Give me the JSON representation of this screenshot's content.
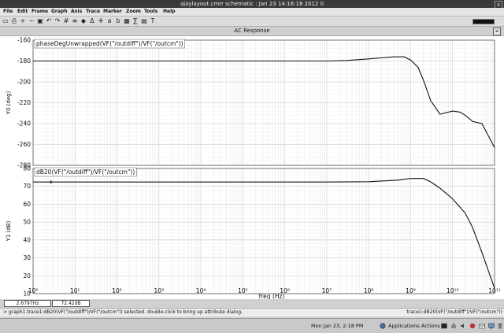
{
  "window": {
    "title": "ajaylayout.cmrr schematic : Jan 23 14:16:18 2012 0",
    "close_glyph": "x"
  },
  "menu": [
    "File",
    "Edit",
    "Frame",
    "Graph",
    "Axis",
    "Trace",
    "Marker",
    "Zoom",
    "Tools",
    "Help"
  ],
  "toolbar_icons": [
    "new-icon",
    "print-icon",
    "zoom-in-icon",
    "zoom-out-icon",
    "fit-icon",
    "undo-icon",
    "redo-icon",
    "grid-icon",
    "strip-icon",
    "marker-icon",
    "delta-icon",
    "crosshair-icon",
    "cursor-a-icon",
    "cursor-b-icon",
    "table-icon",
    "calc-icon",
    "legend-icon",
    "label-icon"
  ],
  "plot_title": "AC Response",
  "header_button": "≡",
  "x_tick_labels": [
    "10⁰",
    "10¹",
    "10²",
    "10³",
    "10⁴",
    "10⁵",
    "10⁶",
    "10⁷",
    "10⁸",
    "10⁹",
    "10¹⁰",
    "10¹¹"
  ],
  "x_axis_label": "freq (Hz)",
  "cursor": {
    "x": "2.6797Hz",
    "y": "72.42dB"
  },
  "status": {
    "left": "> graph1.trace1:dB20(VF(\"/outdiff\")/VF(\"/outcm\")) selected. double-click to bring up attribute dialog.",
    "right": "trace1:dB20(VF(\"/outdiff\")/VF(\"/outcm\"))"
  },
  "taskbar": {
    "datetime": "Mon Jan 23,  2:18 PM",
    "applications": "Applications",
    "actions": "Actions"
  },
  "chart_data": [
    {
      "type": "line",
      "title": "phaseDegUnwrapped(VF(\"/outdiff\")/VF(\"/outcm\"))",
      "xlabel": "freq (Hz)",
      "ylabel": "Y0 (deg)",
      "xscale": "log",
      "xlim": [
        1,
        100000000000
      ],
      "ylim": [
        -280,
        -160
      ],
      "yticks": [
        -160,
        -180,
        -200,
        -220,
        -240,
        -260,
        -280
      ],
      "grid": true,
      "series": [
        {
          "name": "phaseDegUnwrapped(VF(\"/outdiff\")/VF(\"/outcm\"))",
          "x": [
            1,
            1000000,
            10000000,
            30000000,
            100000000,
            200000000,
            400000000,
            700000000,
            1000000000,
            1500000000,
            2000000000,
            3000000000,
            5000000000,
            10000000000,
            15000000000,
            20000000000,
            30000000000,
            50000000000,
            100000000000
          ],
          "y": [
            -180,
            -180,
            -180,
            -179.5,
            -178,
            -177,
            -176,
            -176,
            -179,
            -186,
            -198,
            -218,
            -231,
            -228,
            -229,
            -232,
            -238,
            -240,
            -263
          ]
        }
      ]
    },
    {
      "type": "line",
      "title": "dB20(VF(\"/outdiff\")/VF(\"/outcm\"))",
      "xlabel": "freq (Hz)",
      "ylabel": "Y1 (dB)",
      "xscale": "log",
      "xlim": [
        1,
        100000000000
      ],
      "ylim": [
        10,
        80
      ],
      "yticks": [
        80,
        70,
        60,
        50,
        40,
        30,
        20,
        10
      ],
      "grid": true,
      "series": [
        {
          "name": "dB20(VF(\"/outdiff\")/VF(\"/outcm\"))",
          "x": [
            1,
            2.6797,
            10000000,
            100000000,
            500000000,
            1000000000,
            2000000000,
            3000000000,
            5000000000,
            10000000000,
            20000000000,
            30000000000,
            50000000000,
            100000000000
          ],
          "y": [
            72.42,
            72.42,
            72.42,
            72.6,
            73.5,
            74.4,
            74.4,
            72.5,
            69,
            63,
            55,
            47,
            33,
            13
          ]
        }
      ]
    }
  ],
  "colors": {
    "trace": "#111111",
    "grid": "#c8c8c8",
    "plot_bg": "#ffffff",
    "frame": "#555555"
  }
}
